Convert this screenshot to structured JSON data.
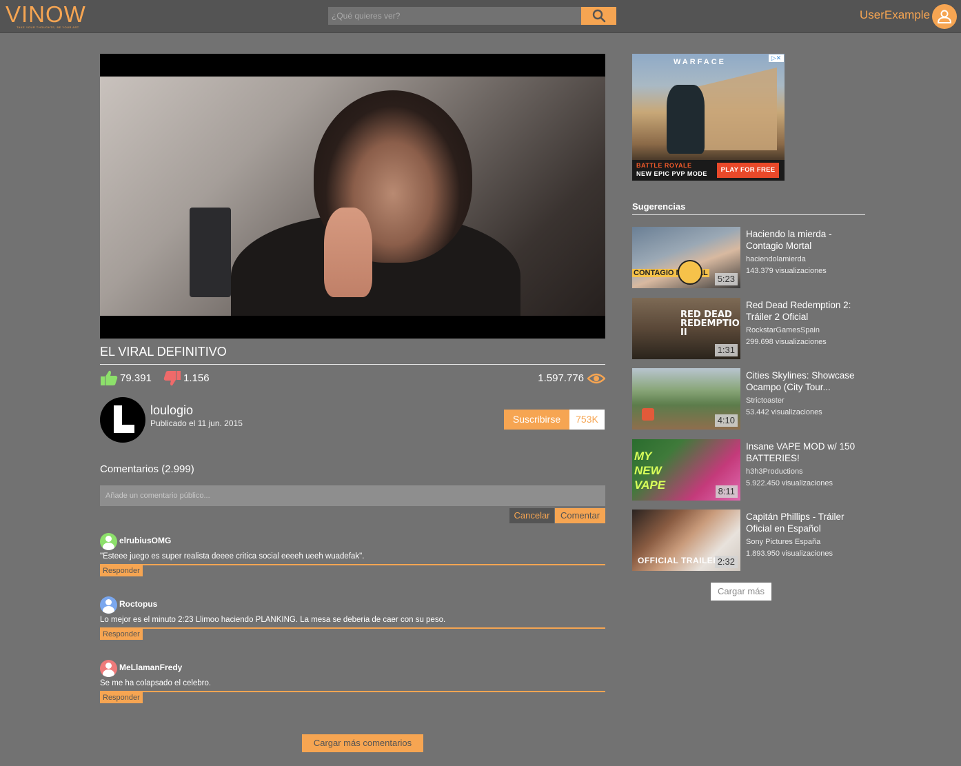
{
  "header": {
    "logo": "VINOW",
    "tagline": "TAKE YOUR THOUGHTS, BE YOUR ART",
    "search_placeholder": "¿Qué quieres ver?",
    "username": "UserExample"
  },
  "video": {
    "title": "EL VIRAL DEFINITIVO",
    "likes": "79.391",
    "dislikes": "1.156",
    "views": "1.597.776",
    "channel": "loulogio",
    "published": "Publicado el 11 jun. 2015",
    "subscribe_label": "Suscribirse",
    "subscribers": "753K"
  },
  "comments": {
    "title": "Comentarios (2.999)",
    "placeholder": "Añade un comentario público...",
    "cancel_label": "Cancelar",
    "comment_label": "Comentar",
    "reply_label": "Responder",
    "load_more": "Cargar más comentarios",
    "items": [
      {
        "user": "elrubiusOMG",
        "text": "\"Esteee juego es super realista deeee critica social eeeeh ueeh wuadefak\".",
        "avatar_color": "#8de06b"
      },
      {
        "user": "Roctopus",
        "text": "Lo mejor es el minuto 2:23 Llimoo haciendo PLANKING. La mesa se deberia de caer con su peso.",
        "avatar_color": "#7aa7ee"
      },
      {
        "user": "MeLlamanFredy",
        "text": "Se me ha colapsado el celebro.",
        "avatar_color": "#ef7a7a"
      }
    ]
  },
  "ad": {
    "brand": "WARFACE",
    "line1": "BATTLE ROYALE",
    "line2": "NEW EPIC PVP MODE",
    "cta": "PLAY FOR FREE"
  },
  "sidebar": {
    "title": "Sugerencias",
    "load_more": "Cargar más",
    "items": [
      {
        "title": "Haciendo la mierda - Contagio Mortal",
        "channel": "haciendolamierda",
        "views": "143.379 visualizaciones",
        "duration": "5:23",
        "overlay": "CONTAGIO MORTAL"
      },
      {
        "title": "Red Dead Redemption 2: Tráiler 2 Oficial",
        "channel": "RockstarGamesSpain",
        "views": "299.698 visualizaciones",
        "duration": "1:31",
        "overlay": "RED DEAD REDEMPTION II"
      },
      {
        "title": "Cities Skylines: Showcase Ocampo (City Tour...",
        "channel": "Strictoaster",
        "views": "53.442 visualizaciones",
        "duration": "4:10",
        "overlay": ""
      },
      {
        "title": "Insane VAPE MOD w/ 150 BATTERIES!",
        "channel": "h3h3Productions",
        "views": "5.922.450 visualizaciones",
        "duration": "8:11",
        "overlay": "MY NEW VAPE"
      },
      {
        "title": "Capitán Phillips - Tráiler Oficial en Español",
        "channel": "Sony Pictures España",
        "views": "1.893.950 visualizaciones",
        "duration": "2:32",
        "overlay": "OFFICIAL TRAILER"
      }
    ]
  },
  "colors": {
    "accent": "#f6a552",
    "header": "#545454",
    "background": "#727272",
    "like": "#8de06b",
    "dislike": "#ef6a6a"
  }
}
